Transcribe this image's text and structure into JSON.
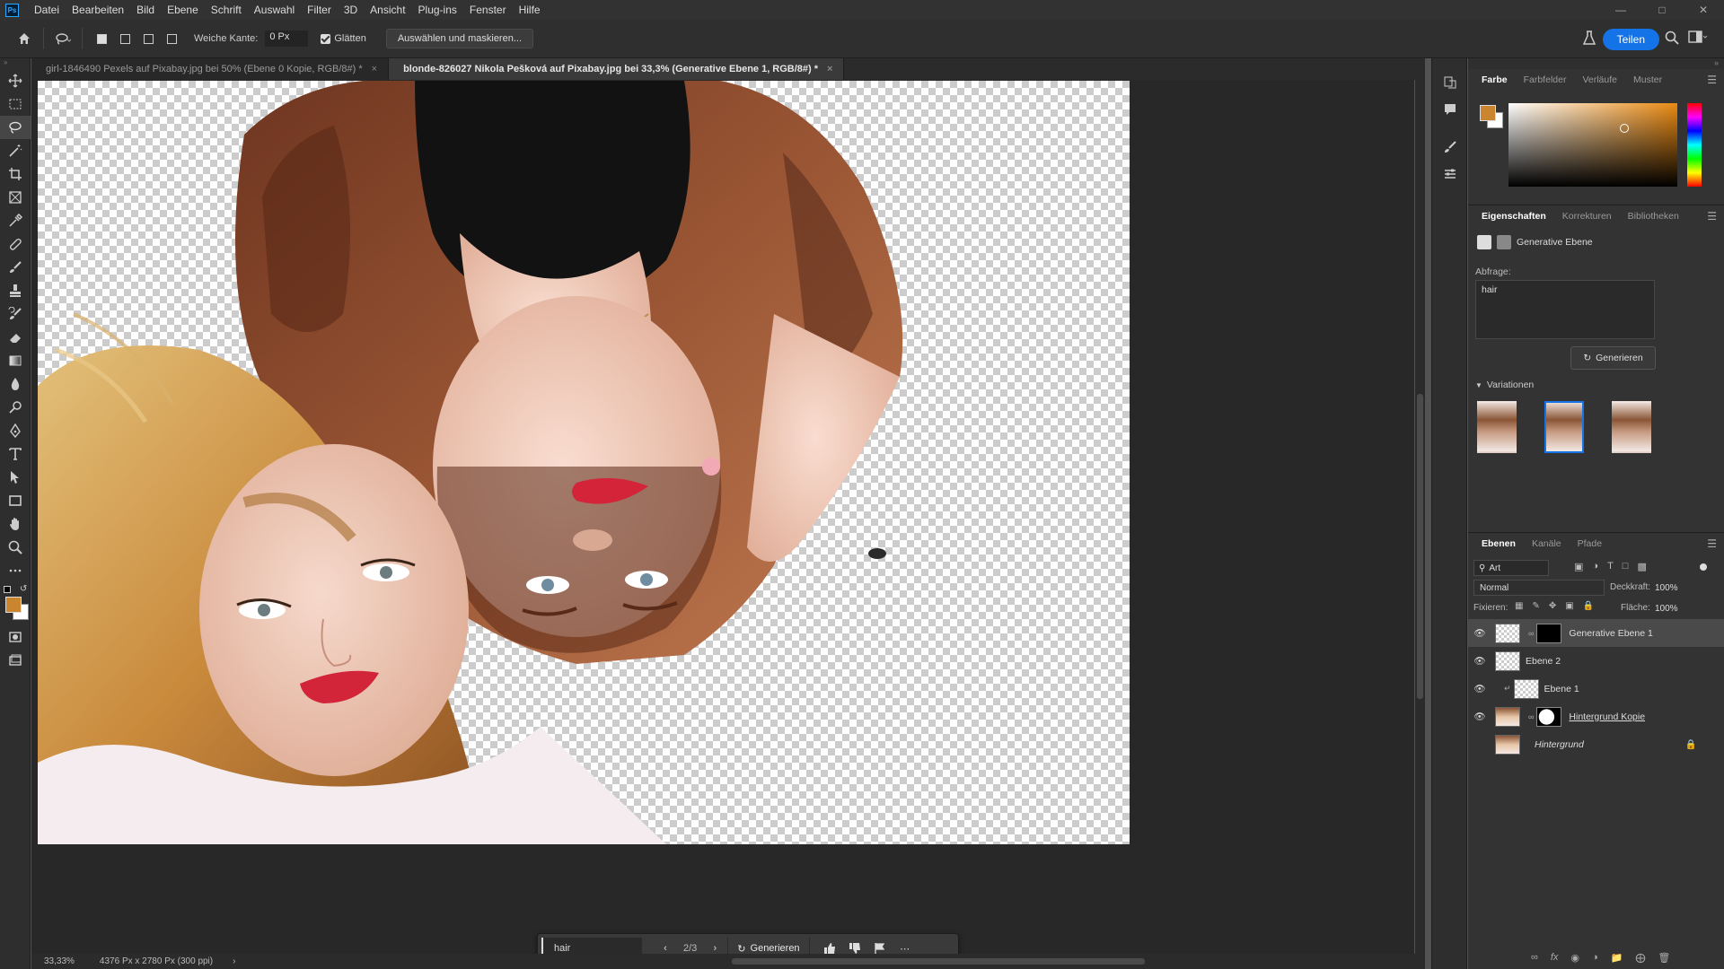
{
  "app": {
    "logo": "Ps"
  },
  "menu": [
    "Datei",
    "Bearbeiten",
    "Bild",
    "Ebene",
    "Schrift",
    "Auswahl",
    "Filter",
    "3D",
    "Ansicht",
    "Plug-ins",
    "Fenster",
    "Hilfe"
  ],
  "options": {
    "feather_label": "Weiche Kante:",
    "feather_value": "0 Px",
    "smooth_label": "Glätten",
    "select_mask_label": "Auswählen und maskieren...",
    "share_label": "Teilen"
  },
  "tabs": [
    {
      "label": "girl-1846490 Pexels auf Pixabay.jpg bei 50% (Ebene 0 Kopie, RGB/8#) *",
      "close": "×"
    },
    {
      "label": "blonde-826027 Nikola Pešková auf Pixabay.jpg bei 33,3% (Generative Ebene 1, RGB/8#) *",
      "close": "×"
    }
  ],
  "taskbar": {
    "prompt": "hair",
    "count": "2/3",
    "generate_label": "Generieren"
  },
  "status": {
    "zoom": "33,33%",
    "doc_info": "4376 Px x 2780 Px (300 ppi)"
  },
  "color_panel": {
    "tabs": [
      "Farbe",
      "Farbfelder",
      "Verläufe",
      "Muster"
    ],
    "foreground": "#c9862f",
    "background": "#ffffff"
  },
  "properties": {
    "tabs": [
      "Eigenschaften",
      "Korrekturen",
      "Bibliotheken"
    ],
    "layer_type": "Generative Ebene",
    "query_label": "Abfrage:",
    "query_value": "hair",
    "generate_label": "Generieren",
    "variations_label": "Variationen",
    "selected_variation": 2
  },
  "layers": {
    "tabs": [
      "Ebenen",
      "Kanäle",
      "Pfade"
    ],
    "filter_label": "Art",
    "blend_mode": "Normal",
    "opacity_label": "Deckkraft:",
    "opacity": "100%",
    "lock_label": "Fixieren:",
    "fill_label": "Fläche:",
    "fill": "100%",
    "items": [
      {
        "name": "Generative Ebene 1",
        "visible": true,
        "selected": true
      },
      {
        "name": "Ebene 2",
        "visible": true,
        "selected": false
      },
      {
        "name": "Ebene 1",
        "visible": true,
        "selected": false
      },
      {
        "name": "Hintergrund Kopie",
        "visible": true,
        "selected": false
      },
      {
        "name": "Hintergrund",
        "visible": false,
        "selected": false
      }
    ]
  },
  "colors": {
    "accent": "#1473e6"
  }
}
